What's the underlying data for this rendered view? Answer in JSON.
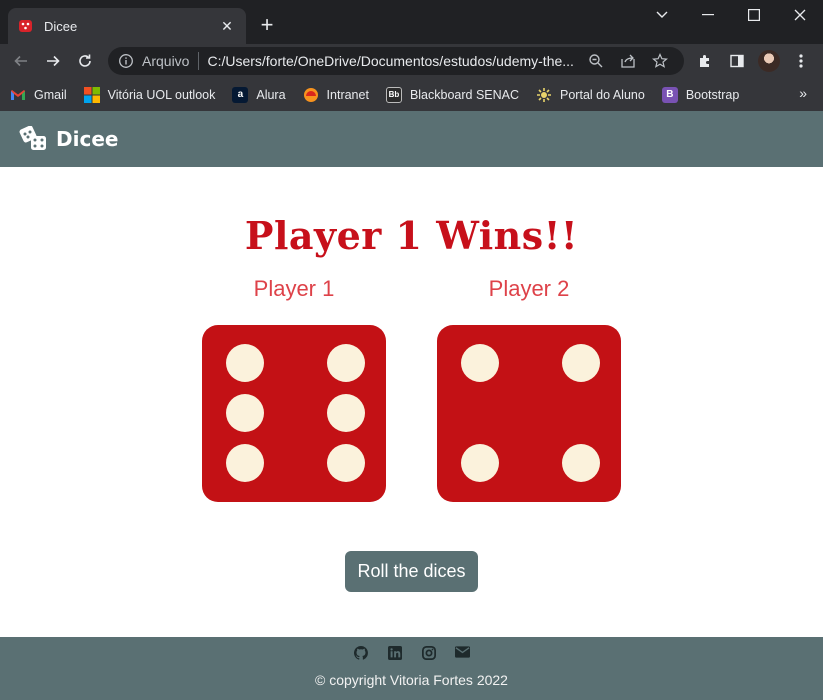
{
  "browser": {
    "tab_title": "Dicee",
    "tab_close": "✕",
    "new_tab": "+",
    "omnibox_info": "Arquivo",
    "url": "C:/Users/forte/OneDrive/Documentos/estudos/udemy-the...",
    "bookmarks": [
      {
        "label": "Gmail",
        "icon": "gmail-icon"
      },
      {
        "label": "Vitória UOL outlook",
        "icon": "microsoft-icon"
      },
      {
        "label": "Alura",
        "icon": "alura-icon"
      },
      {
        "label": "Intranet",
        "icon": "intranet-icon"
      },
      {
        "label": "Blackboard SENAC",
        "icon": "blackboard-icon"
      },
      {
        "label": "Portal do Aluno",
        "icon": "portal-icon"
      },
      {
        "label": "Bootstrap",
        "icon": "bootstrap-icon"
      }
    ],
    "bookmarks_more": "»"
  },
  "site": {
    "brand": "Dicee",
    "winner_text": "Player 1 Wins!!",
    "players": [
      {
        "label": "Player 1",
        "die_value": 6
      },
      {
        "label": "Player 2",
        "die_value": 4
      }
    ],
    "roll_button": "Roll the dices",
    "social_icons": [
      "github-icon",
      "linkedin-icon",
      "instagram-icon",
      "email-icon"
    ],
    "copyright": "© copyright Vitoria Fortes 2022"
  },
  "colors": {
    "accent_red": "#c7101b",
    "die_red": "#c31115",
    "pip_cream": "#fbf2dc",
    "nav_slate": "#5a7073"
  }
}
